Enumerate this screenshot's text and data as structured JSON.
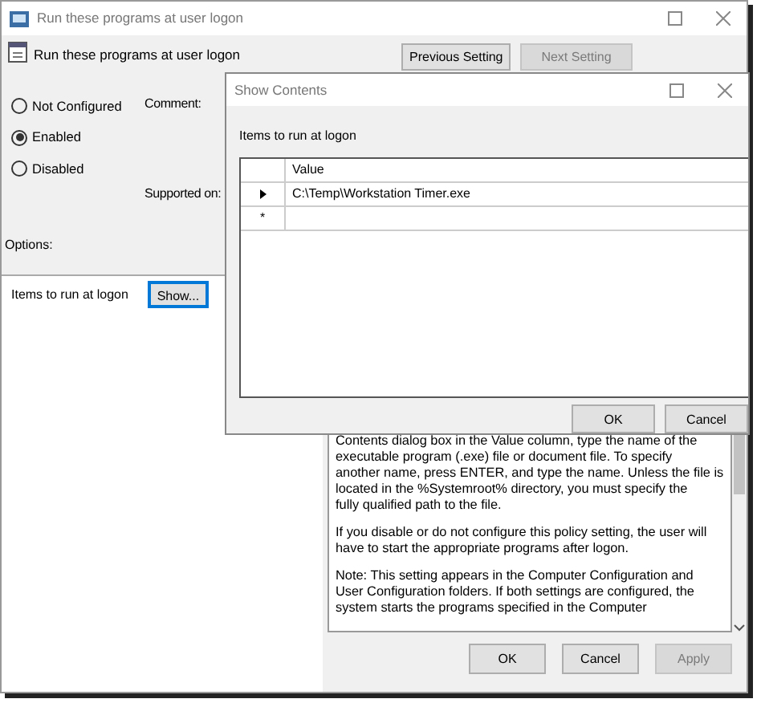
{
  "window": {
    "title": "Run these programs at user logon"
  },
  "header": {
    "title": "Run these programs at user logon"
  },
  "nav_buttons": [
    {
      "label": "Previous Setting",
      "disabled": false
    },
    {
      "label": "Next Setting",
      "disabled": true
    }
  ],
  "radios": [
    {
      "label": "Not Configured",
      "selected": false
    },
    {
      "label": "Enabled",
      "selected": true
    },
    {
      "label": "Disabled",
      "selected": false
    }
  ],
  "comment_label": "Comment:",
  "supported_label": "Supported on:",
  "options_label": "Options:",
  "option": {
    "label": "Items to run at logon",
    "button": "Show..."
  },
  "help_text": [
    "Contents dialog box in the Value column, type the name of the\nexecutable program (.exe) file or document file. To specify\nanother name, press ENTER, and type the name. Unless the file is\nlocated in the %Systemroot% directory, you must specify the\nfully qualified path to the file.",
    "If you disable or do not configure this policy setting, the user will\nhave to start the appropriate programs after logon.",
    "Note: This setting appears in the Computer Configuration and\nUser Configuration folders. If both settings are configured, the\nsystem starts the programs specified in the Computer"
  ],
  "footer_buttons": [
    {
      "label": "OK",
      "disabled": false
    },
    {
      "label": "Cancel",
      "disabled": false
    },
    {
      "label": "Apply",
      "disabled": true
    }
  ],
  "dialog": {
    "title": "Show Contents",
    "prompt": "Items to run at logon",
    "columns": [
      "Value"
    ],
    "rows": [
      {
        "kind": "current",
        "value": "C:\\Temp\\Workstation Timer.exe"
      },
      {
        "kind": "new",
        "marker": "*"
      }
    ],
    "buttons": [
      "OK",
      "Cancel"
    ]
  }
}
